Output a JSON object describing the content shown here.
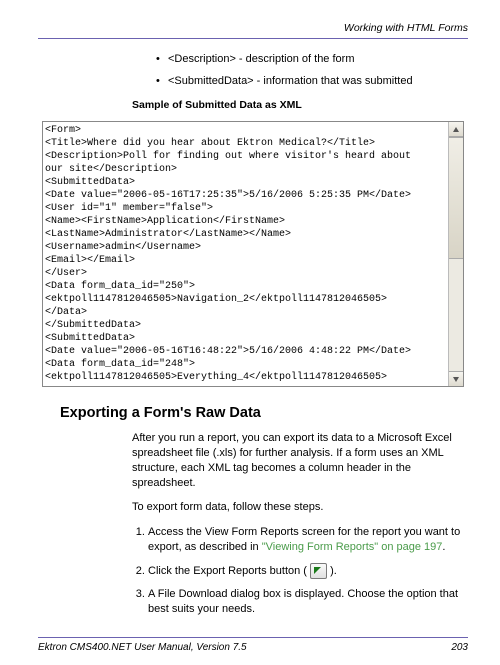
{
  "header": {
    "section_title": "Working with HTML Forms"
  },
  "bullets": [
    {
      "tag": "<Description>",
      "text": " - description of the form"
    },
    {
      "tag": "<SubmittedData>",
      "text": " - information that was submitted"
    }
  ],
  "sample_heading": "Sample of Submitted Data as XML",
  "code": "<Form>\n<Title>Where did you hear about Ektron Medical?</Title>\n<Description>Poll for finding out where visitor's heard about\nour site</Description>\n<SubmittedData>\n<Date value=\"2006-05-16T17:25:35\">5/16/2006 5:25:35 PM</Date>\n<User id=\"1\" member=\"false\">\n<Name><FirstName>Application</FirstName>\n<LastName>Administrator</LastName></Name>\n<Username>admin</Username>\n<Email></Email>\n</User>\n<Data form_data_id=\"250\">\n<ektpoll1147812046505>Navigation_2</ektpoll1147812046505>\n</Data>\n</SubmittedData>\n<SubmittedData>\n<Date value=\"2006-05-16T16:48:22\">5/16/2006 4:48:22 PM</Date>\n<Data form_data_id=\"248\">\n<ektpoll1147812046505>Everything_4</ektpoll1147812046505>",
  "export": {
    "heading": "Exporting a Form's Raw Data",
    "para1": "After you run a report, you can export its data to a Microsoft Excel spreadsheet file (.xls) for further analysis. If a form uses an XML structure, each XML tag becomes a column header in the spreadsheet.",
    "para2": "To export form data, follow these steps.",
    "steps": {
      "s1a": "Access the View Form Reports screen for the report you want to export, as described in ",
      "s1b": "\"Viewing Form Reports\" on page 197",
      "s1c": ".",
      "s2a": "Click the Export Reports button ( ",
      "s2b": " ).",
      "s3": "A File Download dialog box is displayed. Choose the option that best suits your needs."
    }
  },
  "footer": {
    "left": "Ektron CMS400.NET User Manual, Version 7.5",
    "right": "203"
  }
}
